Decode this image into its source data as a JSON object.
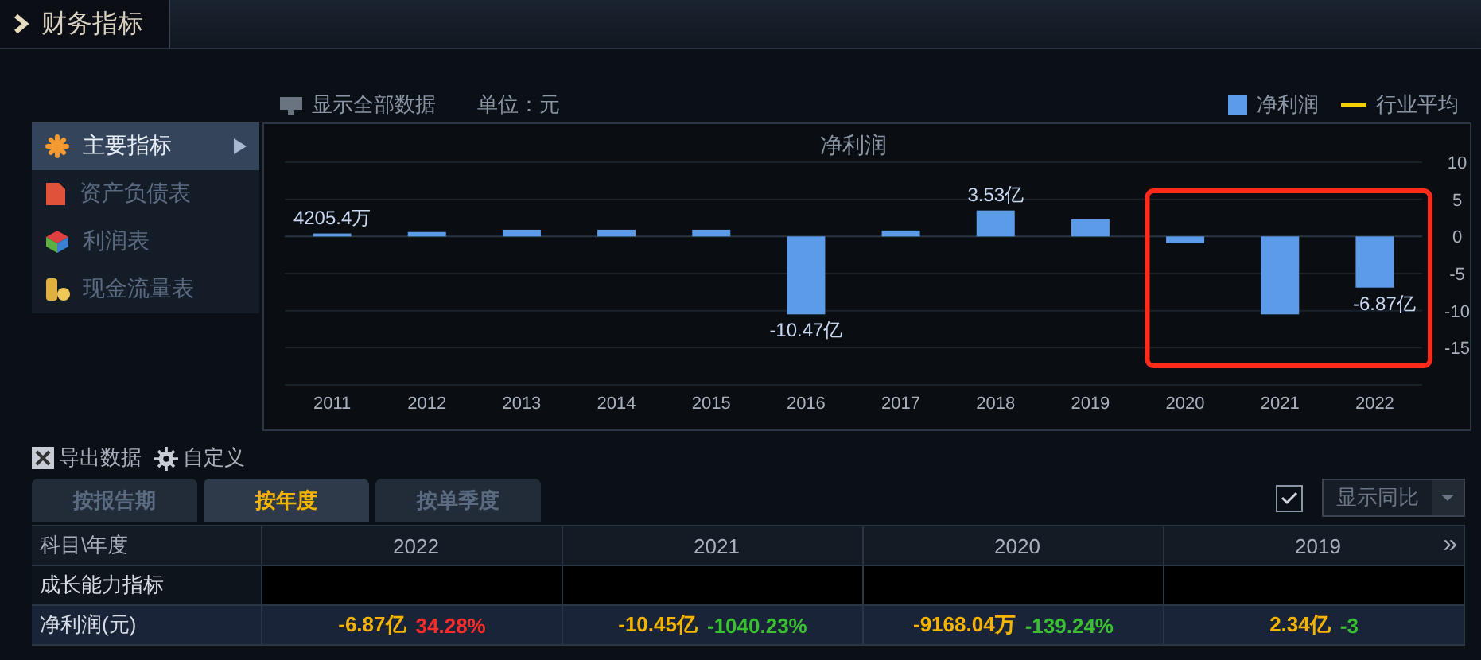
{
  "header": {
    "title": "财务指标"
  },
  "toolbar": {
    "show_all": "显示全部数据",
    "unit": "单位：元"
  },
  "legend": [
    {
      "kind": "series"
    },
    {
      "kind": "line",
      "label": "行业平均",
      "color": "#f5d000"
    }
  ],
  "sidebar": {
    "items": [
      {
        "label": "主要指标",
        "selected": true
      },
      {
        "label": "资产负债表",
        "selected": false
      },
      {
        "label": "利润表",
        "selected": false
      },
      {
        "label": "现金流量表",
        "selected": false
      }
    ]
  },
  "chart_data": {
    "type": "bar",
    "title": "净利润",
    "categories": [
      "2011",
      "2012",
      "2013",
      "2014",
      "2015",
      "2016",
      "2017",
      "2018",
      "2019",
      "2020",
      "2021",
      "2022"
    ],
    "series": [
      {
        "name": "净利润",
        "color": "#5b9be8",
        "values": [
          0.4,
          0.6,
          0.9,
          0.9,
          0.9,
          -10.5,
          0.8,
          3.5,
          2.3,
          -0.9,
          -10.5,
          -6.9
        ]
      }
    ],
    "ylim": [
      -20,
      10
    ],
    "yticks": [
      10,
      5,
      0,
      -5,
      -10,
      -15
    ],
    "grid": true,
    "value_labels": [
      "4205.4万",
      null,
      null,
      null,
      null,
      "-10.47亿",
      null,
      "3.53亿",
      null,
      null,
      null,
      "-6.87亿"
    ]
  },
  "highlight_frame": {
    "shown": true
  },
  "actions": [
    {
      "kind": "export",
      "label": "导出数据"
    },
    {
      "kind": "settings",
      "label": "自定义"
    }
  ],
  "tabs": [
    {
      "label": "按报告期",
      "selected": false
    },
    {
      "label": "按年度",
      "selected": true
    },
    {
      "label": "按单季度",
      "selected": false
    }
  ],
  "yoy": {
    "label": "显示同比",
    "checked": true
  },
  "table": {
    "columns": [
      "科目\\年度",
      "2022",
      "2021",
      "2020",
      "2019"
    ],
    "more": "»",
    "rows": [
      {
        "kind": "section",
        "label": "成长能力指标"
      },
      {
        "kind": "data",
        "label": "净利润(元)",
        "cells": [
          {
            "value": "-6.87亿",
            "change": "34.28%",
            "color": "#ff2a2a"
          },
          {
            "value": "-10.45亿",
            "change": "-1040.23%",
            "color": "#3ac030"
          },
          {
            "value": "-9168.04万",
            "change": "-139.24%",
            "color": "#3ac030"
          },
          {
            "value": "2.34亿",
            "change": "-3",
            "color": "#3ac030"
          }
        ]
      }
    ]
  }
}
